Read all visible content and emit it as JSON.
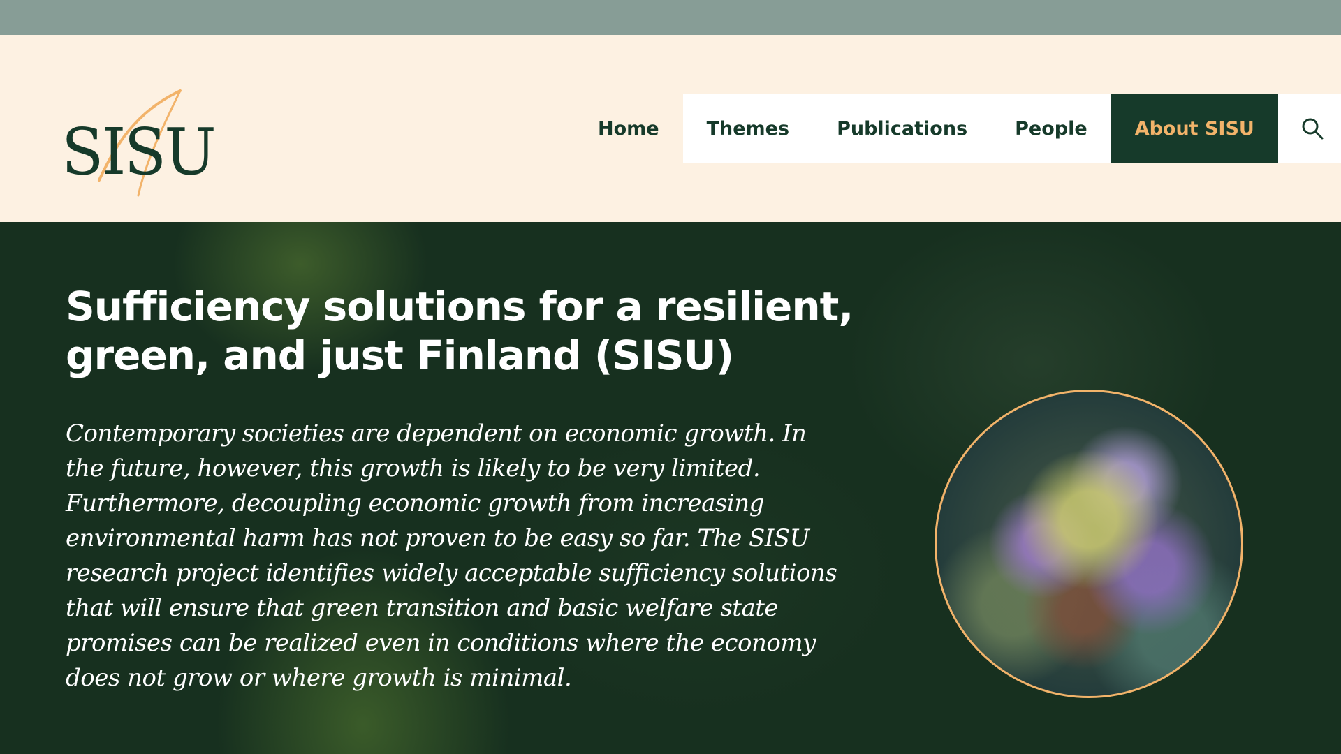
{
  "colors": {
    "top_strip": "#879d96",
    "header_bg": "#fdf1e2",
    "brand_dark": "#163a2a",
    "accent": "#f2b36a",
    "hero_bg": "#17301f"
  },
  "logo": {
    "text": "SISU"
  },
  "nav": {
    "items": [
      {
        "label": "Home"
      },
      {
        "label": "Themes"
      },
      {
        "label": "Publications"
      },
      {
        "label": "People"
      },
      {
        "label": "About SISU",
        "active": true
      }
    ],
    "search_icon": "search-icon"
  },
  "hero": {
    "title": "Sufficiency solutions for a resilient, green, and just Finland (SISU)",
    "text": "Contemporary societies are dependent on economic growth. In the future, however, this growth is likely to be very limited. Furthermore, decoupling economic growth from increasing environmental harm has not proven to be easy so far. The SISU research project identifies widely acceptable sufficiency solutions that will ensure that green transition and basic welfare state promises can be realized even in conditions where the economy does not grow or where growth is minimal."
  }
}
